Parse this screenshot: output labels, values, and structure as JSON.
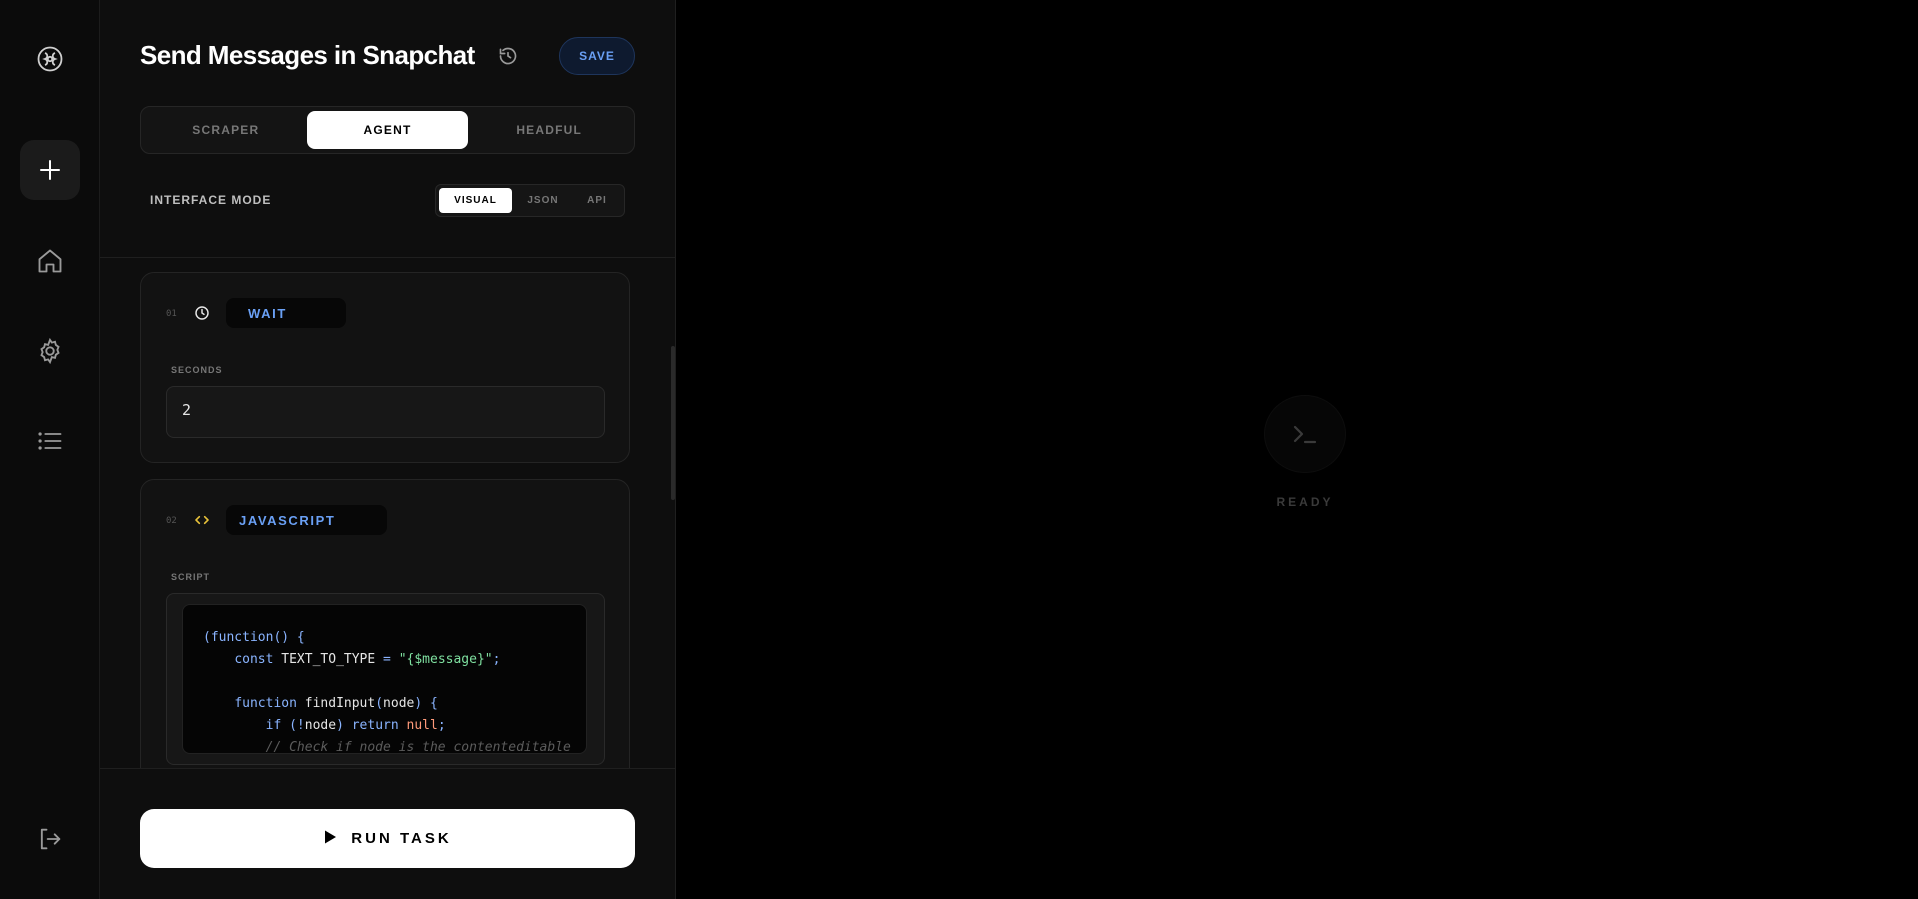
{
  "header": {
    "title": "Send Messages in Snapchat",
    "save_label": "SAVE"
  },
  "task_type_tabs": [
    {
      "label": "SCRAPER",
      "active": false
    },
    {
      "label": "AGENT",
      "active": true
    },
    {
      "label": "HEADFUL",
      "active": false
    }
  ],
  "interface_mode": {
    "label": "INTERFACE MODE",
    "options": [
      {
        "label": "VISUAL",
        "active": true
      },
      {
        "label": "JSON",
        "active": false
      },
      {
        "label": "API",
        "active": false
      }
    ]
  },
  "steps": [
    {
      "number": "01",
      "type": "WAIT",
      "icon": "clock-icon",
      "field_label": "SECONDS",
      "value": "2"
    },
    {
      "number": "02",
      "type": "JAVASCRIPT",
      "icon": "code-icon",
      "field_label": "SCRIPT",
      "code_lines": [
        "(function() {",
        "    const TEXT_TO_TYPE = \"{$message}\";",
        "",
        "    function findInput(node) {",
        "        if (!node) return null;",
        "        // Check if node is the contenteditable"
      ]
    }
  ],
  "run_button_label": "RUN TASK",
  "output": {
    "status": "READY",
    "icon": "terminal-icon"
  },
  "colors": {
    "accent": "#6aa0f5",
    "background": "#000000",
    "panel": "#0e0e0e",
    "code_keyword": "#8ab4ff",
    "code_string": "#7fe0a0",
    "code_null": "#ff9a7a",
    "code_icon": "#e8c23a"
  }
}
